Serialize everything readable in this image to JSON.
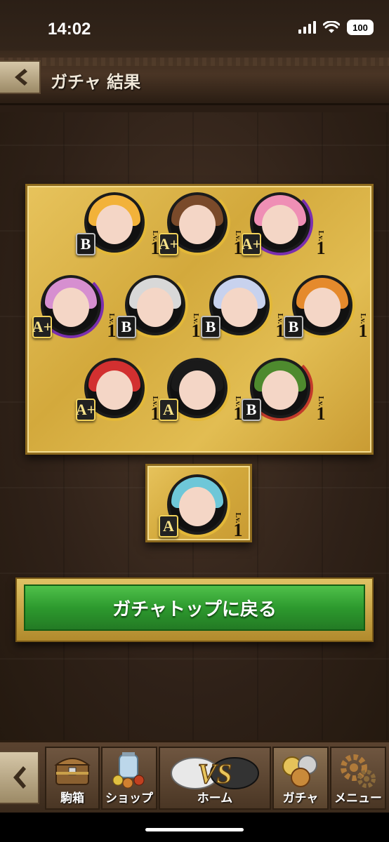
{
  "status": {
    "time": "14:02",
    "battery": "100"
  },
  "header": {
    "title": "ガチャ 結果"
  },
  "results": [
    {
      "rank": "B",
      "lv_label": "Lv.",
      "lv": "1",
      "hair": "#f2b23a",
      "ring": "#e3b838"
    },
    {
      "rank": "A+",
      "lv_label": "Lv.",
      "lv": "1",
      "hair": "#7a4a2a",
      "ring": "#e3b838"
    },
    {
      "rank": "A+",
      "lv_label": "Lv.",
      "lv": "1",
      "hair": "#ef8fb5",
      "ring": "#7b2fae"
    },
    {
      "rank": "A+",
      "lv_label": "Lv.",
      "lv": "1",
      "hair": "#d68fd0",
      "ring": "#7b2fae"
    },
    {
      "rank": "B",
      "lv_label": "Lv.",
      "lv": "1",
      "hair": "#d8d8d8",
      "ring": "#e3b838"
    },
    {
      "rank": "B",
      "lv_label": "Lv.",
      "lv": "1",
      "hair": "#c8d2ee",
      "ring": "#e3b838"
    },
    {
      "rank": "B",
      "lv_label": "Lv.",
      "lv": "1",
      "hair": "#e58a2c",
      "ring": "#e3b838"
    },
    {
      "rank": "A+",
      "lv_label": "Lv.",
      "lv": "1",
      "hair": "#d23030",
      "ring": "#e3b838"
    },
    {
      "rank": "A",
      "lv_label": "Lv.",
      "lv": "1",
      "hair": "#1a1a1a",
      "ring": "#e3b838"
    },
    {
      "rank": "B",
      "lv_label": "Lv.",
      "lv": "1",
      "hair": "#4e8a2e",
      "ring": "#c23a2a"
    }
  ],
  "bonus": {
    "rank": "A",
    "lv_label": "Lv.",
    "lv": "1",
    "hair": "#6ec7d8",
    "ring": "#e3b838"
  },
  "actions": {
    "back_to_top": "ガチャトップに戻る"
  },
  "nav": {
    "items": [
      {
        "label": "駒箱",
        "icon": "chest-icon"
      },
      {
        "label": "ショップ",
        "icon": "shop-icon"
      },
      {
        "label": "ホーム",
        "icon": "vs-icon"
      },
      {
        "label": "ガチャ",
        "icon": "coins-icon"
      },
      {
        "label": "メニュー",
        "icon": "gears-icon"
      }
    ],
    "home_logo": "VS"
  }
}
